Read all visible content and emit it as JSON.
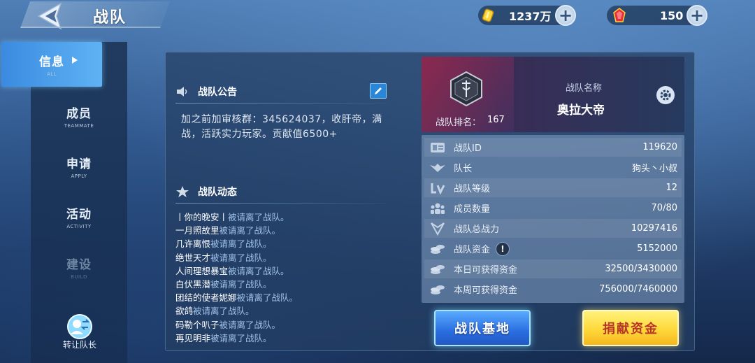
{
  "header": {
    "title": "战队",
    "gold": {
      "amount": "1237万",
      "icon": "gold-coin-icon"
    },
    "gems": {
      "amount": "150",
      "icon": "red-gem-icon"
    },
    "plus": "+"
  },
  "sidebar": {
    "items": [
      {
        "cn": "信息",
        "en": "ALL",
        "state": "active"
      },
      {
        "cn": "成员",
        "en": "TEAMMATE",
        "state": "normal"
      },
      {
        "cn": "申请",
        "en": "APPLY",
        "state": "normal"
      },
      {
        "cn": "活动",
        "en": "ACTIVITY",
        "state": "normal"
      },
      {
        "cn": "建设",
        "en": "BUILD",
        "state": "disabled"
      }
    ],
    "transfer_label": "转让队长"
  },
  "announcement": {
    "title": "战队公告",
    "text": "加之前加审核群：345624037，收肝帝，满战，活跃实力玩家。贡献值6500+"
  },
  "activity": {
    "title": "战队动态",
    "entries": [
      {
        "who": "丨你的晚安丨",
        "action": "被请离了战队。"
      },
      {
        "who": "一月照故里",
        "action": "被请离了战队。"
      },
      {
        "who": "几许离恨",
        "action": "被请离了战队。"
      },
      {
        "who": "绝世天才",
        "action": "被请离了战队。"
      },
      {
        "who": "人间理想暴宝",
        "action": "被请离了战队。"
      },
      {
        "who": "白伏黑潜",
        "action": "被请离了战队。"
      },
      {
        "who": "团结的使者妮娜",
        "action": "被请离了战队。"
      },
      {
        "who": "欲鸽",
        "action": "被请离了战队。"
      },
      {
        "who": "码勒个叭子",
        "action": "被请离了战队。"
      },
      {
        "who": "再见明非",
        "action": "被请离了战队。"
      }
    ]
  },
  "team_card": {
    "rank_label": "战队排名：",
    "rank_value": "167",
    "name_label": "战队名称",
    "name_value": "奥拉大帝"
  },
  "stats": [
    {
      "icon": "id-card-icon",
      "label": "战队ID",
      "value": "119620"
    },
    {
      "icon": "wings-badge-icon",
      "label": "队长",
      "value": "狗头丶小叔"
    },
    {
      "icon": "level-icon",
      "label": "战队等级",
      "value": "12"
    },
    {
      "icon": "members-icon",
      "label": "成员数量",
      "value": "70/80"
    },
    {
      "icon": "power-icon",
      "label": "战队总战力",
      "value": "10297416"
    },
    {
      "icon": "coins-icon",
      "label": "战队资金",
      "value": "5152000",
      "warn": "!"
    },
    {
      "icon": "coins-icon",
      "label": "本日可获得资金",
      "value": "32500/3430000"
    },
    {
      "icon": "coins-icon",
      "label": "本周可获得资金",
      "value": "756000/7460000"
    }
  ],
  "buttons": {
    "base": "战队基地",
    "donate": "捐献资金"
  },
  "colors": {
    "active_tab": "#3a8be0",
    "blue_button": "#2a6ee0",
    "yellow_button": "#ffd83a",
    "donate_text": "#b7352a"
  }
}
